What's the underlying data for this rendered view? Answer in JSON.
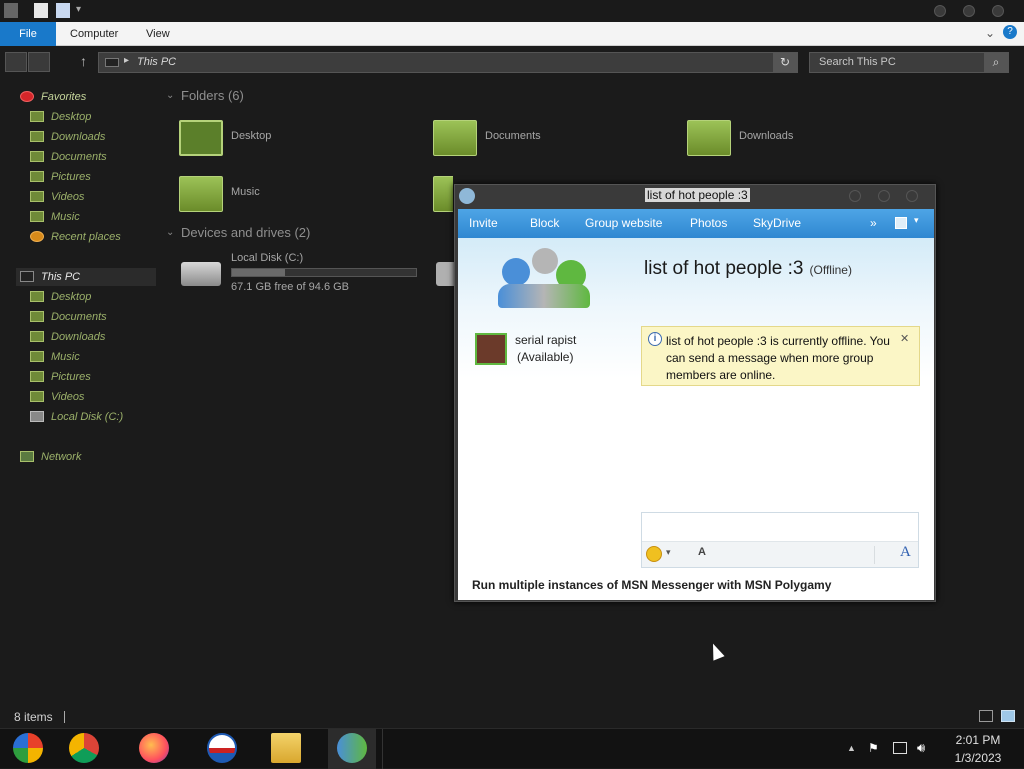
{
  "explorer": {
    "ribbon_tabs": [
      "File",
      "Computer",
      "View"
    ],
    "address": "This PC",
    "search_placeholder": "Search This PC",
    "status": "8 items"
  },
  "nav": {
    "favorites": "Favorites",
    "favorite_items": [
      "Desktop",
      "Downloads",
      "Documents",
      "Pictures",
      "Videos",
      "Music",
      "Recent places"
    ],
    "this_pc": "This PC",
    "this_pc_items": [
      "Desktop",
      "Documents",
      "Downloads",
      "Music",
      "Pictures",
      "Videos",
      "Local Disk (C:)"
    ],
    "network": "Network"
  },
  "content": {
    "folders_head": "Folders (6)",
    "folders": [
      "Desktop",
      "Documents",
      "Downloads",
      "Music"
    ],
    "devices_head": "Devices and drives (2)",
    "drive": {
      "name": "Local Disk (C:)",
      "free": "67.1 GB free of 94.6 GB",
      "used_fraction": 0.29
    }
  },
  "msn": {
    "title": "list of hot people :3",
    "toolbar": [
      "Invite",
      "Block",
      "Group website",
      "Photos",
      "SkyDrive"
    ],
    "overflow": "»",
    "group_name": "list of hot people :3",
    "group_status": "(Offline)",
    "member_name": "serial rapist",
    "member_status": "(Available)",
    "info_message": "list of hot people :3 is currently offline. You can send a message when more group members are online.",
    "info_close": "✕",
    "ad": "Run multiple instances of MSN Messenger with MSN Polygamy"
  },
  "taskbar": {
    "time": "2:01 PM",
    "date": "1/3/2023"
  },
  "colors": {
    "accent": "#1979ca",
    "folder_green": "#7fa43b",
    "msn_toolbar": "#3a94da"
  }
}
